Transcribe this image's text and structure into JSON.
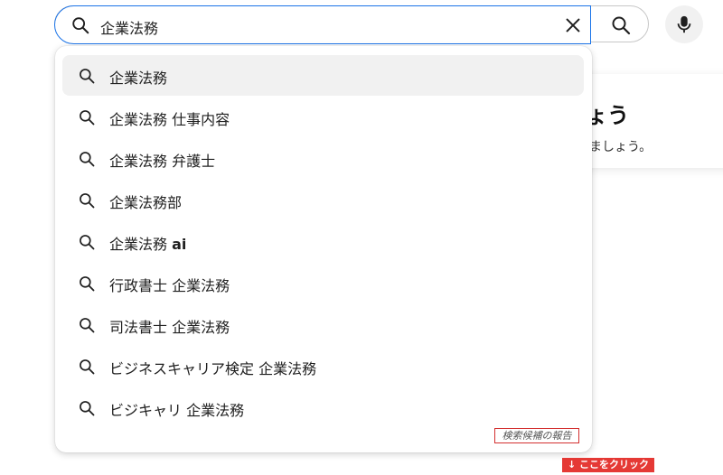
{
  "search": {
    "query": "企業法務",
    "clear_icon": "close-icon",
    "search_icon": "search-icon",
    "mic_icon": "microphone-icon"
  },
  "background_card": {
    "heading": "ょう",
    "sub": "しましょう。"
  },
  "suggestions": [
    {
      "prefix": "企業法務",
      "bold": "",
      "active": true
    },
    {
      "prefix": "企業法務 仕事内容",
      "bold": "",
      "active": false
    },
    {
      "prefix": "企業法務 弁護士",
      "bold": "",
      "active": false
    },
    {
      "prefix": "企業法務部",
      "bold": "",
      "active": false
    },
    {
      "prefix": "企業法務 ",
      "bold": "ai",
      "active": false
    },
    {
      "prefix": "行政書士 企業法務",
      "bold": "",
      "active": false
    },
    {
      "prefix": "司法書士 企業法務",
      "bold": "",
      "active": false
    },
    {
      "prefix": "ビジネスキャリア検定 企業法務",
      "bold": "",
      "active": false
    },
    {
      "prefix": "ビジキャリ 企業法務",
      "bold": "",
      "active": false
    }
  ],
  "annotation": {
    "click_here": "↓ ここをクリック",
    "report": "検索候補の報告"
  },
  "colors": {
    "focus_border": "#1a73e8",
    "annotation_red": "#e53935"
  }
}
